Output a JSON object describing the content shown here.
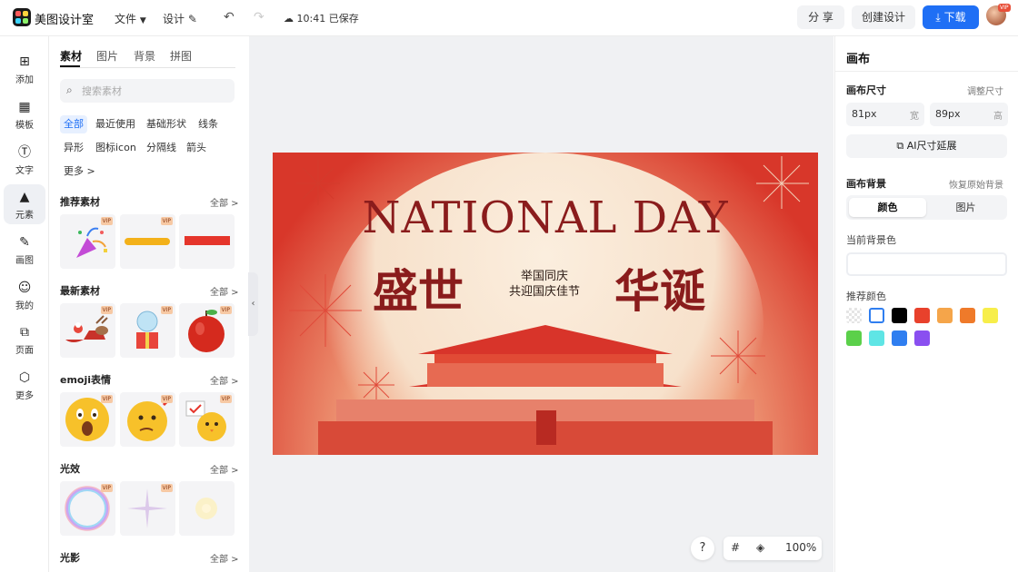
{
  "app": {
    "name": "美图设计室",
    "menu_file": "文件",
    "menu_design": "设计",
    "saved_status": "10:41 已保存",
    "share": "分 享",
    "create_design": "创建设计",
    "download": "下载",
    "avatar_badge": "VIP"
  },
  "rail": [
    {
      "label": "添加",
      "icon": "plus-square-icon"
    },
    {
      "label": "模板",
      "icon": "layout-icon"
    },
    {
      "label": "文字",
      "icon": "text-icon"
    },
    {
      "label": "元素",
      "icon": "shapes-icon"
    },
    {
      "label": "画图",
      "icon": "pen-edit-icon"
    },
    {
      "label": "我的",
      "icon": "user-icon"
    },
    {
      "label": "页面",
      "icon": "page-add-icon"
    },
    {
      "label": "更多",
      "icon": "cube-icon"
    }
  ],
  "panel": {
    "tabs": [
      "素材",
      "图片",
      "背景",
      "拼图"
    ],
    "search_placeholder": "搜索素材",
    "chips": [
      "全部",
      "最近使用",
      "基础形状",
      "线条",
      "异形",
      "图标icon",
      "分隔线",
      "箭头",
      "更多 >"
    ],
    "all_label": "全部 >",
    "vip": "VIP",
    "sections": [
      {
        "title": "推荐素材",
        "items": [
          "party-popper",
          "yellow-brush-stroke",
          "red-bar"
        ]
      },
      {
        "title": "最新素材",
        "items": [
          "santa-sleigh",
          "snow-globe-gift",
          "red-apple"
        ]
      },
      {
        "title": "emoji表情",
        "items": [
          "shocked-emoji",
          "thinking-emoji",
          "chick-emoji"
        ]
      },
      {
        "title": "光效",
        "items": [
          "light-ring",
          "sparkle",
          "glow"
        ]
      },
      {
        "title": "光影",
        "items": []
      }
    ]
  },
  "poster": {
    "title": "NATIONAL DAY",
    "left_text": "盛世",
    "right_text": "华诞",
    "slogan_line1": "举国同庆",
    "slogan_line2": "共迎国庆佳节"
  },
  "canvas_tools": {
    "help": "?",
    "zoom": "100%"
  },
  "props": {
    "heading": "画布",
    "size_label": "画布尺寸",
    "adjust_size": "调整尺寸",
    "width_value": "81px",
    "width_unit": "宽",
    "height_value": "89px",
    "height_unit": "高",
    "ai_extend": "AI尺寸延展",
    "bg_label": "画布背景",
    "restore_bg": "恢复原始背景",
    "bg_tab_color": "颜色",
    "bg_tab_image": "图片",
    "current_bg": "当前背景色",
    "recommended": "推荐颜色",
    "swatches": [
      "transparent",
      "#ffffff",
      "#000000",
      "#e8412c",
      "#f5a54a",
      "#ef7a2a",
      "#f7ee4a",
      "#5bd04a",
      "#5fe5e5",
      "#2f7ef0",
      "#8a4ff0"
    ]
  }
}
